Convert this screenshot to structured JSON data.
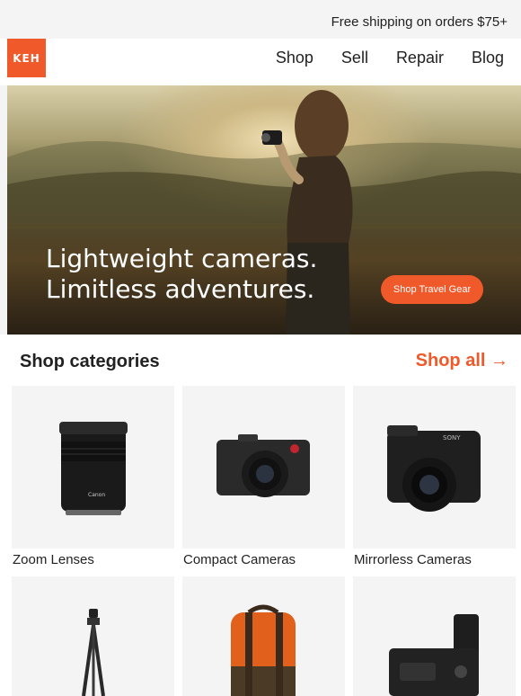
{
  "topbar": {
    "shipping_text": "Free shipping on orders $75+"
  },
  "brand": {
    "logo_text": "KEH",
    "accent": "#f0592a"
  },
  "nav": {
    "items": [
      "Shop",
      "Sell",
      "Repair",
      "Blog"
    ]
  },
  "hero": {
    "headline_line1": "Lightweight cameras.",
    "headline_line2": "Limitless adventures.",
    "cta_label": "Shop Travel Gear"
  },
  "categories": {
    "title": "Shop categories",
    "shop_all": "Shop all →",
    "items": [
      {
        "label": "Zoom Lenses",
        "icon": "zoom-lens-icon"
      },
      {
        "label": "Compact Cameras",
        "icon": "compact-camera-icon"
      },
      {
        "label": "Mirrorless Cameras",
        "icon": "mirrorless-camera-icon"
      },
      {
        "label": "",
        "icon": "tripod-icon"
      },
      {
        "label": "",
        "icon": "backpack-icon"
      },
      {
        "label": "",
        "icon": "battery-grip-icon"
      }
    ]
  }
}
